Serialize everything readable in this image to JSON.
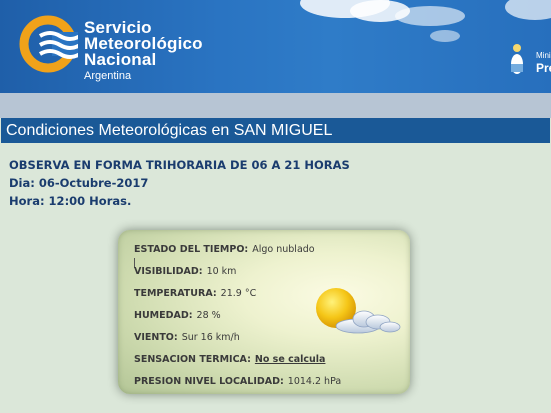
{
  "header": {
    "brand_line1": "Servicio",
    "brand_line2": "Meteorológico",
    "brand_line3": "Nacional",
    "brand_line4": "Argentina",
    "right_line1": "Minis",
    "right_line2": "Pre"
  },
  "page": {
    "title": "Condiciones Meteorológicas en SAN MIGUEL",
    "observa": "OBSERVA EN FORMA TRIHORARIA DE 06 A 21 HORAS",
    "dia": "Dia: 06-Octubre-2017",
    "hora": "Hora: 12:00 Horas."
  },
  "conditions": {
    "estado_label": "ESTADO DEL TIEMPO:",
    "estado_value": "Algo nublado",
    "visibilidad_label": "VISIBILIDAD:",
    "visibilidad_value": "10 km",
    "temperatura_label": "TEMPERATURA:",
    "temperatura_value": "21.9 °C",
    "humedad_label": "HUMEDAD:",
    "humedad_value": "28 %",
    "viento_label": "VIENTO:",
    "viento_value": "Sur 16 km/h",
    "sensacion_label": "SENSACION TERMICA:",
    "sensacion_value": "No se calcula",
    "presion_label": "PRESION NIVEL LOCALIDAD:",
    "presion_value": "1014.2 hPa"
  },
  "icons": {
    "weather": "partly-cloudy-icon",
    "logo": "smn-logo-icon",
    "emblem": "argentina-emblem-icon"
  },
  "colors": {
    "header_blue": "#2a74c2",
    "title_bar": "#1a5997",
    "page_bg": "#dbe7d9",
    "info_text": "#1a3c6e"
  }
}
